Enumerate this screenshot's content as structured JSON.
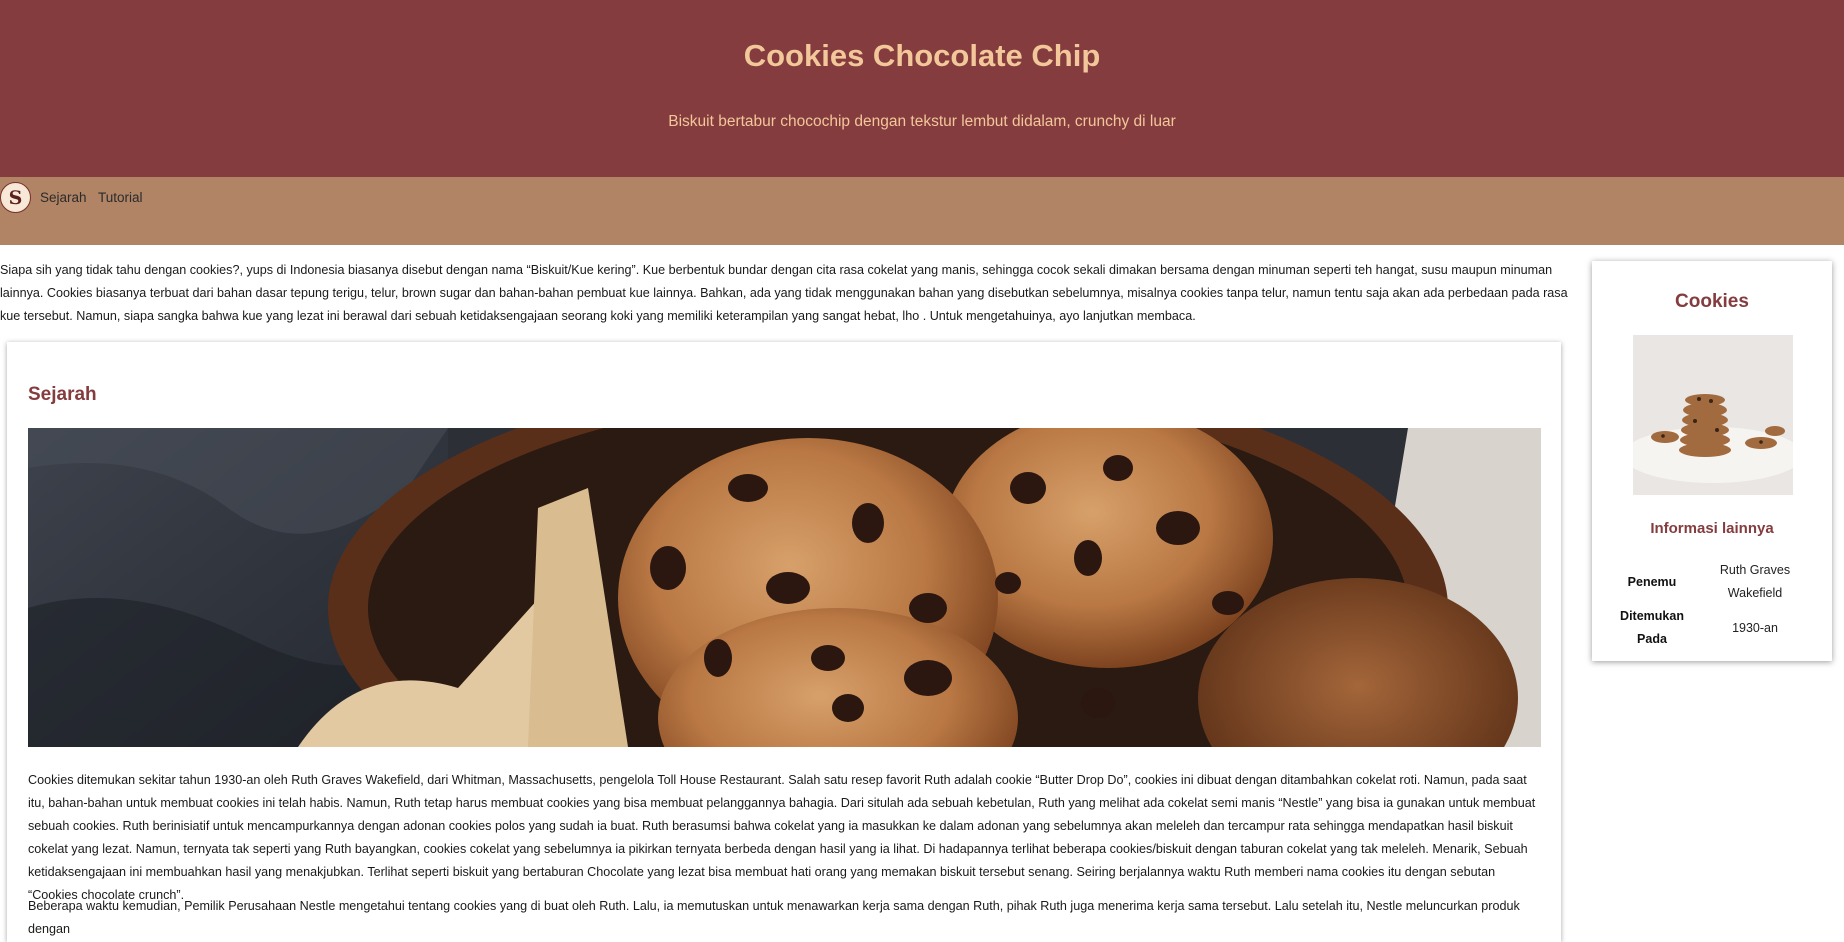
{
  "header": {
    "title": "Cookies Chocolate Chip",
    "subtitle": "Biskuit bertabur chocochip dengan tekstur lembut didalam, crunchy di luar"
  },
  "nav": {
    "logo_letter": "S",
    "items": [
      {
        "label": "Sejarah"
      },
      {
        "label": "Tutorial"
      }
    ]
  },
  "intro": "Siapa sih yang tidak tahu dengan cookies?, yups di Indonesia biasanya disebut dengan nama “Biskuit/Kue kering”. Kue berbentuk bundar dengan cita rasa cokelat yang manis, sehingga cocok sekali dimakan bersama dengan minuman seperti teh hangat, susu maupun minuman lainnya. Cookies biasanya terbuat dari bahan dasar tepung terigu, telur, brown sugar dan bahan-bahan pembuat kue lainnya. Bahkan, ada yang tidak menggunakan bahan yang disebutkan sebelumnya, misalnya cookies tanpa telur, namun tentu saja akan ada perbedaan pada rasa kue tersebut. Namun, siapa sangka bahwa kue yang lezat ini berawal dari sebuah ketidaksengajaan seorang koki yang memiliki keterampilan yang sangat hebat, lho . Untuk mengetahuinya, ayo lanjutkan membaca.",
  "article": {
    "heading": "Sejarah",
    "paragraphs": [
      "Cookies ditemukan sekitar tahun 1930-an oleh Ruth Graves Wakefield, dari Whitman, Massachusetts, pengelola Toll House Restaurant. Salah satu resep favorit Ruth adalah cookie “Butter Drop Do”, cookies ini dibuat dengan ditambahkan cokelat roti. Namun, pada saat itu, bahan-bahan untuk membuat cookies ini telah habis. Namun, Ruth tetap harus membuat cookies yang bisa membuat pelanggannya bahagia. Dari situlah ada sebuah kebetulan, Ruth yang melihat ada cokelat semi manis “Nestle” yang bisa ia gunakan untuk membuat sebuah cookies. Ruth berinisiatif untuk mencampurkannya dengan adonan cookies polos yang sudah ia buat. Ruth berasumsi bahwa cokelat yang ia masukkan ke dalam adonan yang sebelumnya akan meleleh dan tercampur rata sehingga mendapatkan hasil biskuit cokelat yang lezat. Namun, ternyata tak seperti yang Ruth bayangkan, cookies cokelat yang sebelumnya ia pikirkan ternyata berbeda dengan hasil yang ia lihat. Di hadapannya terlihat beberapa cookies/biskuit dengan taburan cokelat yang tak meleleh. Menarik, Sebuah ketidaksengajaan ini membuahkan hasil yang menakjubkan. Terlihat seperti biskuit yang bertaburan Chocolate yang lezat bisa membuat hati orang yang memakan biskuit tersebut senang. Seiring berjalannya waktu Ruth memberi nama cookies itu dengan sebutan “Cookies chocolate crunch”.",
      "Beberapa waktu kemudian, Pemilik Perusahaan Nestle mengetahui tentang cookies yang di buat oleh Ruth. Lalu, ia memutuskan untuk menawarkan kerja sama dengan Ruth, pihak Ruth juga menerima kerja sama tersebut. Lalu setelah itu, Nestle meluncurkan produk dengan"
    ]
  },
  "aside": {
    "title": "Cookies",
    "subtitle": "Informasi lainnya",
    "rows": [
      {
        "key": "Penemu",
        "value": "Ruth Graves Wakefield"
      },
      {
        "key": "Ditemukan Pada",
        "value": "1930-an"
      }
    ]
  },
  "colors": {
    "header_bg": "#843c3e",
    "header_text": "#f2c79a",
    "nav_bg": "#b08465",
    "accent": "#843c3e"
  }
}
